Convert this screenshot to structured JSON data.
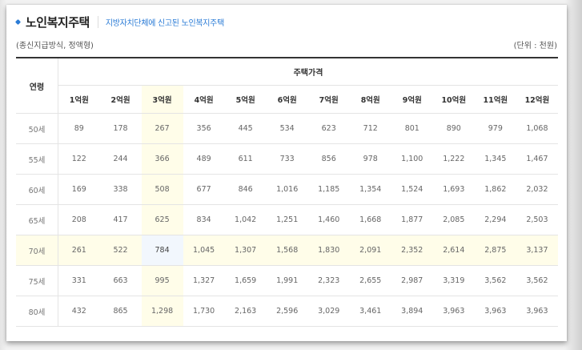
{
  "header": {
    "title": "노인복지주택",
    "subtitle": "지방자치단체에 신고된 노인복지주택"
  },
  "meta": {
    "method": "(종신지급방식, 정액형)",
    "unit": "(단위 : 천원)"
  },
  "table": {
    "age_header": "연령",
    "group_header": "주택가격",
    "columns": [
      "1억원",
      "2억원",
      "3억원",
      "4억원",
      "5억원",
      "6억원",
      "7억원",
      "8억원",
      "9억원",
      "10억원",
      "11억원",
      "12억원"
    ],
    "rows": [
      {
        "age": "50세",
        "values": [
          "89",
          "178",
          "267",
          "356",
          "445",
          "534",
          "623",
          "712",
          "801",
          "890",
          "979",
          "1,068"
        ]
      },
      {
        "age": "55세",
        "values": [
          "122",
          "244",
          "366",
          "489",
          "611",
          "733",
          "856",
          "978",
          "1,100",
          "1,222",
          "1,345",
          "1,467"
        ]
      },
      {
        "age": "60세",
        "values": [
          "169",
          "338",
          "508",
          "677",
          "846",
          "1,016",
          "1,185",
          "1,354",
          "1,524",
          "1,693",
          "1,862",
          "2,032"
        ]
      },
      {
        "age": "65세",
        "values": [
          "208",
          "417",
          "625",
          "834",
          "1,042",
          "1,251",
          "1,460",
          "1,668",
          "1,877",
          "2,085",
          "2,294",
          "2,503"
        ]
      },
      {
        "age": "70세",
        "values": [
          "261",
          "522",
          "784",
          "1,045",
          "1,307",
          "1,568",
          "1,830",
          "2,091",
          "2,352",
          "2,614",
          "2,875",
          "3,137"
        ]
      },
      {
        "age": "75세",
        "values": [
          "331",
          "663",
          "995",
          "1,327",
          "1,659",
          "1,991",
          "2,323",
          "2,655",
          "2,987",
          "3,319",
          "3,562",
          "3,562"
        ]
      },
      {
        "age": "80세",
        "values": [
          "432",
          "865",
          "1,298",
          "1,730",
          "2,163",
          "2,596",
          "3,029",
          "3,461",
          "3,894",
          "3,963",
          "3,963",
          "3,963"
        ]
      }
    ],
    "highlight_column_index": 2,
    "highlight_row_index": 4
  },
  "colors": {
    "accent": "#2a7bd6",
    "highlight": "#fffde9",
    "intersection": "#f2f7fd"
  }
}
